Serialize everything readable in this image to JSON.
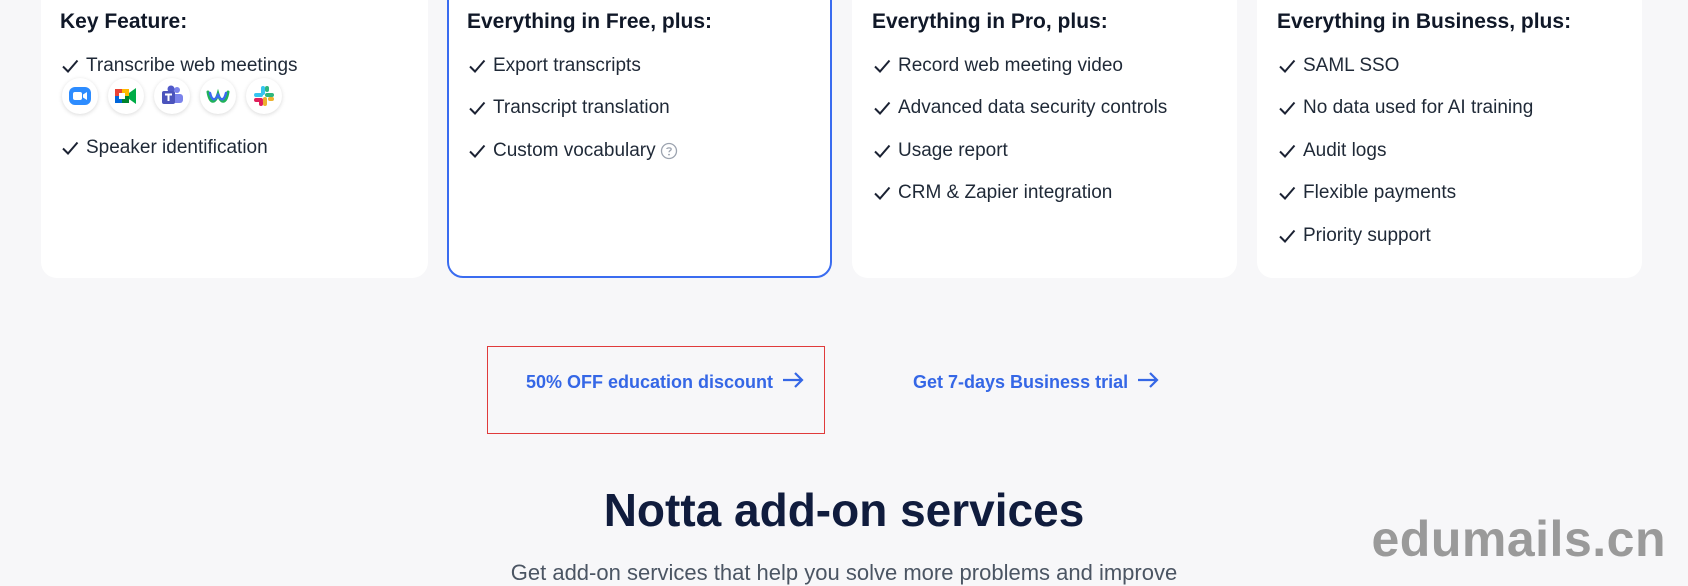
{
  "plans": [
    {
      "title": "Key Feature:",
      "features": [
        "Transcribe web meetings",
        "Speaker identification"
      ],
      "apps": [
        "zoom-icon",
        "google-meet-icon",
        "ms-teams-icon",
        "webex-icon",
        "slack-icon"
      ]
    },
    {
      "title": "Everything in Free, plus:",
      "features": [
        "Export transcripts",
        "Transcript translation",
        "Custom vocabulary"
      ]
    },
    {
      "title": "Everything in Pro, plus:",
      "features": [
        "Record web meeting video",
        "Advanced data security controls",
        "Usage report",
        "CRM & Zapier integration"
      ]
    },
    {
      "title": "Everything in Business, plus:",
      "features": [
        "SAML SSO",
        "No data used for AI training",
        "Audit logs",
        "Flexible payments",
        "Priority support"
      ]
    }
  ],
  "links": {
    "education": "50% OFF education discount",
    "trial": "Get 7-days Business trial"
  },
  "addons": {
    "title": "Notta add-on services",
    "subtitle": "Get add-on services that help you solve more problems and improve"
  },
  "watermark": "edumails.cn",
  "colors": {
    "accent": "#3567e6",
    "highlight_border": "#3a6cf0",
    "annotation": "#e03b3b"
  }
}
